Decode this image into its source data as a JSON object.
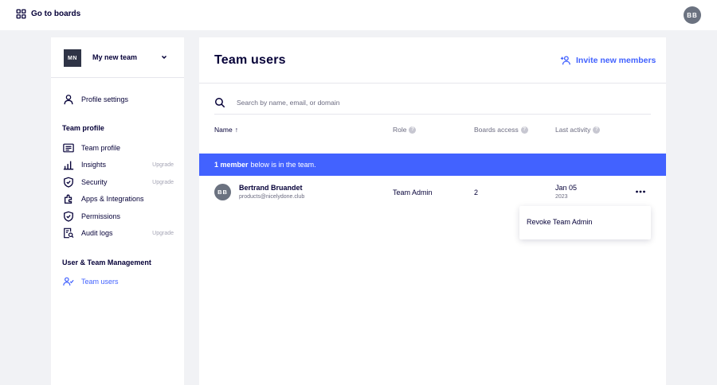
{
  "topbar": {
    "goto_label": "Go to boards",
    "avatar_initials": "BB"
  },
  "sidebar": {
    "team_initials": "MN",
    "team_name": "My new team",
    "profile_settings": "Profile settings",
    "section_team_profile": "Team profile",
    "items": [
      {
        "label": "Team profile",
        "badge": ""
      },
      {
        "label": "Insights",
        "badge": "Upgrade"
      },
      {
        "label": "Security",
        "badge": "Upgrade"
      },
      {
        "label": "Apps & Integrations",
        "badge": ""
      },
      {
        "label": "Permissions",
        "badge": ""
      },
      {
        "label": "Audit logs",
        "badge": "Upgrade"
      }
    ],
    "section_user_mgmt": "User & Team Management",
    "team_users": "Team users"
  },
  "main": {
    "title": "Team users",
    "invite_label": "Invite new members",
    "search_placeholder": "Search by name, email, or domain",
    "columns": {
      "name": "Name",
      "name_sort": "↑",
      "role": "Role",
      "boards": "Boards access",
      "activity": "Last activity"
    },
    "banner": {
      "count": "1 member",
      "text": "below is in the team."
    },
    "rows": [
      {
        "initials": "BB",
        "name": "Bertrand Bruandet",
        "email": "products@nicelydone.club",
        "role": "Team Admin",
        "boards": "2",
        "last_date": "Jan 05",
        "last_year": "2023"
      }
    ],
    "menu": {
      "revoke": "Revoke Team Admin"
    }
  },
  "colors": {
    "accent": "#4262ff",
    "text": "#050038",
    "background": "#f1f2f5"
  }
}
